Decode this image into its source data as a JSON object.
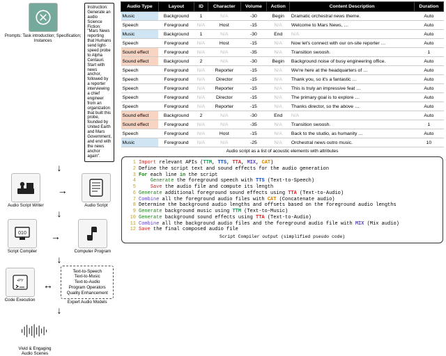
{
  "left": {
    "instruction": "Instruction: Generate an audio Science Fiction: \"Mars News reporting that Humans send light-speed probe to Alpha Centauri. Start with news anchor, followed by a reporter interviewing a chief engineer from an organization that built this probe, founded by United Earth and Mars Government, and end with the news anchor again\".",
    "prompts_caption": "Prompts: Task introduction; Specification; Instances",
    "writer_label": "Audio Script Writer",
    "script_label": "Audio Script",
    "compiler_label": "Script Compiler",
    "program_label": "Computer Program",
    "code_exec_label": "Code Execution",
    "audio_models_label": "Expert Audio Models",
    "models_list": "Text-to-Speech\nText-to-Music\nText-to-Audio\nProgram Operators\nQuality Enhancement",
    "final_label": "Vivid & Engaging Audio Scenes"
  },
  "table": {
    "headers": [
      "Audio Type",
      "Layout",
      "ID",
      "Character",
      "Volume",
      "Action",
      "Content Description",
      "Duration"
    ],
    "rows": [
      {
        "type": "Music",
        "cls": "music",
        "layout": "Background",
        "id": "1",
        "char": "N/A",
        "vol": "-30",
        "act": "Begin",
        "desc": "Dramatic orchestral news theme.",
        "dur": "Auto"
      },
      {
        "type": "Speech",
        "cls": "speech",
        "layout": "Foreground",
        "id": "N/A",
        "char": "Host",
        "vol": "-15",
        "act": "N/A",
        "desc": "Welcome to Mars News, …",
        "dur": "Auto"
      },
      {
        "type": "Music",
        "cls": "music",
        "layout": "Background",
        "id": "1",
        "char": "N/A",
        "vol": "-30",
        "act": "End",
        "desc": "N/A",
        "dur": "Auto"
      },
      {
        "type": "Speech",
        "cls": "speech",
        "layout": "Foreground",
        "id": "N/A",
        "char": "Host",
        "vol": "-15",
        "act": "N/A",
        "desc": "Now let's connect with our on-site reporter …",
        "dur": "Auto"
      },
      {
        "type": "Sound effect",
        "cls": "sound",
        "layout": "Foreground",
        "id": "N/A",
        "char": "N/A",
        "vol": "-35",
        "act": "N/A",
        "desc": "Transition swoosh.",
        "dur": "1"
      },
      {
        "type": "Sound effect",
        "cls": "sound",
        "layout": "Background",
        "id": "2",
        "char": "N/A",
        "vol": "-30",
        "act": "Begin",
        "desc": "Background noise of busy engineering office.",
        "dur": "Auto"
      },
      {
        "type": "Speech",
        "cls": "speech",
        "layout": "Foreground",
        "id": "N/A",
        "char": "Reporter",
        "vol": "-15",
        "act": "N/A",
        "desc": "We're here at the headquarters of …",
        "dur": "Auto"
      },
      {
        "type": "Speech",
        "cls": "speech",
        "layout": "Foreground",
        "id": "N/A",
        "char": "Director",
        "vol": "-15",
        "act": "N/A",
        "desc": "Thank you, so it's a fantastic …",
        "dur": "Auto"
      },
      {
        "type": "Speech",
        "cls": "speech",
        "layout": "Foreground",
        "id": "N/A",
        "char": "Reporter",
        "vol": "-15",
        "act": "N/A",
        "desc": "This is truly an impressive feat …",
        "dur": "Auto"
      },
      {
        "type": "Speech",
        "cls": "speech",
        "layout": "Foreground",
        "id": "N/A",
        "char": "Director",
        "vol": "-15",
        "act": "N/A",
        "desc": "The primary goal is to explore …",
        "dur": "Auto"
      },
      {
        "type": "Speech",
        "cls": "speech",
        "layout": "Foreground",
        "id": "N/A",
        "char": "Reporter",
        "vol": "-15",
        "act": "N/A",
        "desc": "Thanks director, so the above …",
        "dur": "Auto"
      },
      {
        "type": "Sound effect",
        "cls": "sound",
        "layout": "Background",
        "id": "2",
        "char": "N/A",
        "vol": "-30",
        "act": "End",
        "desc": "N/A",
        "dur": "Auto"
      },
      {
        "type": "Sound effect",
        "cls": "sound",
        "layout": "Foreground",
        "id": "N/A",
        "char": "N/A",
        "vol": "-35",
        "act": "N/A",
        "desc": "Transition swoosh.",
        "dur": "1"
      },
      {
        "type": "Speech",
        "cls": "speech",
        "layout": "Foreground",
        "id": "N/A",
        "char": "Host",
        "vol": "-15",
        "act": "N/A",
        "desc": "Back to the studio, as humanity …",
        "dur": "Auto"
      },
      {
        "type": "Music",
        "cls": "music",
        "layout": "Foreground",
        "id": "N/A",
        "char": "N/A",
        "vol": "-25",
        "act": "N/A",
        "desc": "Orchestral news outro music.",
        "dur": "10"
      }
    ],
    "caption": "Audio script as a list of acoustic elements with attributes"
  },
  "code": {
    "lines": [
      {
        "n": "1",
        "html": "<span class='kw-import'>Import</span> relevant APIs (<span class='api-ttm'>TTM</span>, <span class='api-tts'>TTS</span>, <span class='api-tta'>TTA</span>, <span class='api-mix'>MIX</span>, <span class='api-cat'>CAT</span>)"
      },
      {
        "n": "2",
        "html": "Define the script text and sound effects for the audio generation"
      },
      {
        "n": "3",
        "html": "<span class='kw-for'>For</span> each line <span class='kw-for'>in</span> the script"
      },
      {
        "n": "4",
        "html": "&nbsp;&nbsp;&nbsp;&nbsp;<span class='kw-gen'>Generate</span> the foreground speech with <span class='api-tts'>TTS</span> (Text-to-Speech)"
      },
      {
        "n": "5",
        "html": "&nbsp;&nbsp;&nbsp;&nbsp;<span class='kw-save'>Save</span> the audio file and compute its length"
      },
      {
        "n": "6",
        "html": "<span class='kw-gen'>Generate</span> additional foreground sound effects using <span class='api-tta'>TTA</span> (Text-to-Audio)"
      },
      {
        "n": "7",
        "html": "<span class='kw-comb'>Combine</span> all the foreground audio files with <span class='api-cat'>CAT</span> (Concatenate audio)"
      },
      {
        "n": "8",
        "html": "Determine the background audio lengths and offsets based on the foreground audio lengths"
      },
      {
        "n": "9",
        "html": "<span class='kw-gen'>Generate</span> background music using <span class='api-ttm'>TTM</span> (Text-to-Music)"
      },
      {
        "n": "10",
        "html": "<span class='kw-gen'>Generate</span> background sound effects using <span class='api-tta'>TTA</span> (Text-to-Audio)"
      },
      {
        "n": "11",
        "html": "<span class='kw-comb'>Combine</span> all the background audio files and the foreground audio file with <span class='api-mix'>MIX</span> (Mix audio)"
      },
      {
        "n": "12",
        "html": "<span class='kw-save'>Save</span> the final composed audio file"
      }
    ],
    "caption": "Script Compiler output (simplified pseudo code)"
  }
}
